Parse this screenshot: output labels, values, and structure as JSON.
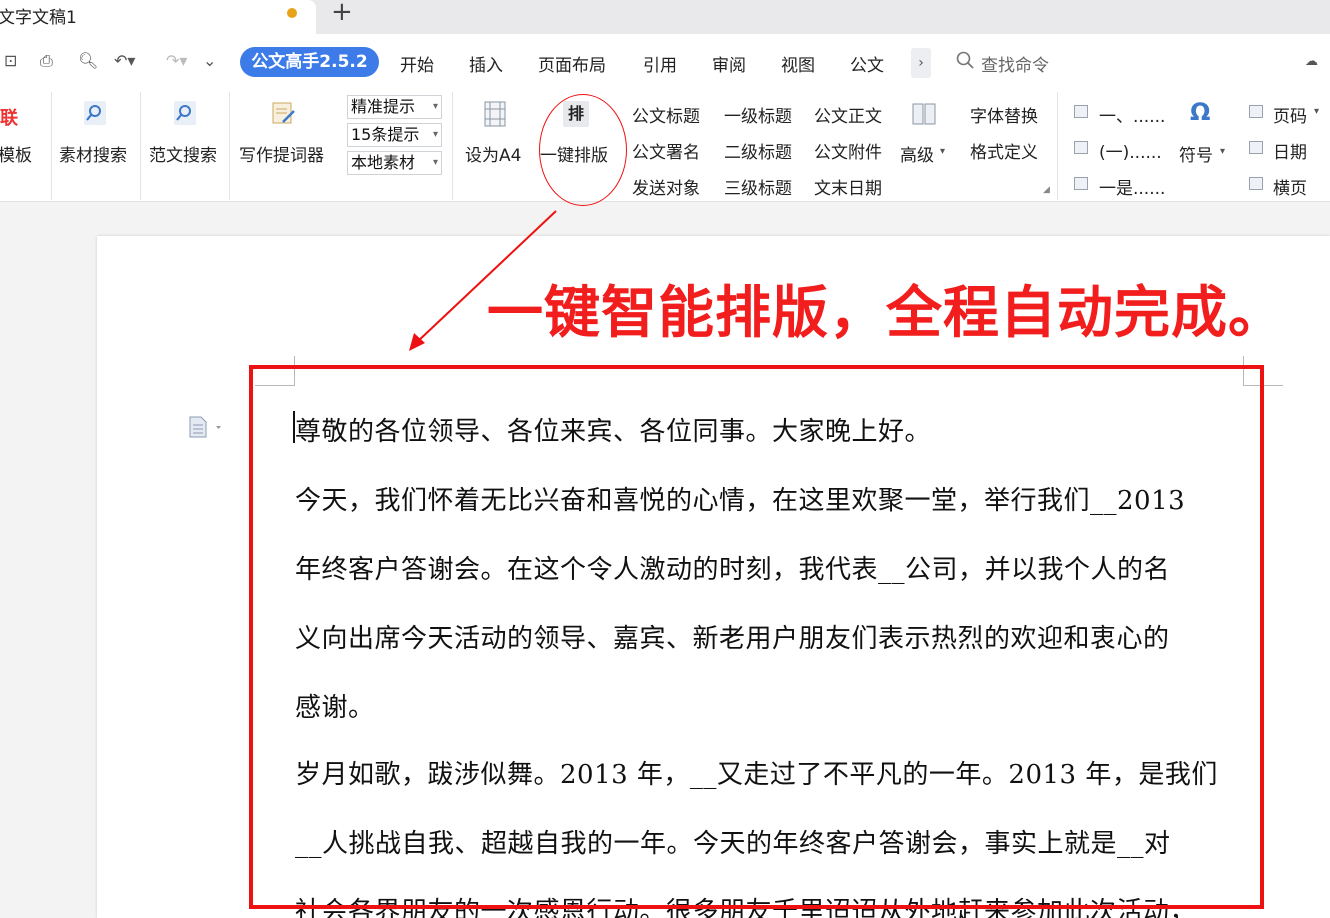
{
  "tab": {
    "title": "文字文稿1"
  },
  "brand_button": "公文高手2.5.2",
  "menu": [
    "开始",
    "插入",
    "页面布局",
    "引用",
    "审阅",
    "视图",
    "公文"
  ],
  "more_label": "›",
  "search": {
    "text": "查找命令"
  },
  "ribbon": {
    "templates": {
      "label": "模板",
      "icon_text": "联"
    },
    "material_search": {
      "label": "素材搜索"
    },
    "sample_search": {
      "label": "范文搜索"
    },
    "writing_prompter": {
      "label": "写作提词器"
    },
    "dropdowns": [
      "精准提示",
      "15条提示",
      "本地素材"
    ],
    "set_a4": {
      "label": "设为A4"
    },
    "one_key_layout": {
      "label": "一键排版",
      "icon_text": "排"
    },
    "doc_buttons": [
      [
        "公文标题",
        "一级标题",
        "公文正文"
      ],
      [
        "公文署名",
        "二级标题",
        "公文附件"
      ],
      [
        "发送对象",
        "三级标题",
        "文末日期"
      ]
    ],
    "advanced": {
      "label": "高级"
    },
    "font_replace": "字体替换",
    "format_define": "格式定义",
    "numbering": [
      "一、......",
      "(一)......",
      "一是......"
    ],
    "symbol": {
      "label": "符号",
      "icon_text": "Ω"
    },
    "page_items": [
      "页码",
      "日期",
      "横页"
    ]
  },
  "headline": "一键智能排版，全程自动完成。",
  "document": {
    "lines": [
      "尊敬的各位领导、各位来宾、各位同事。大家晚上好。",
      "今天，我们怀着无比兴奋和喜悦的心情，在这里欢聚一堂，举行我们__2013",
      "年终客户答谢会。在这个令人激动的时刻，我代表__公司，并以我个人的名",
      "义向出席今天活动的领导、嘉宾、新老用户朋友们表示热烈的欢迎和衷心的",
      "感谢。",
      "岁月如歌，跋涉似舞。2013 年，__又走过了不平凡的一年。2013 年，是我们",
      "__人挑战自我、超越自我的一年。今天的年终客户答谢会，事实上就是__对",
      "社会各界朋友的一次感恩行动。很多朋友千里迢迢从外地赶来参加此次活动，"
    ]
  },
  "colors": {
    "accent": "#3c7be8",
    "annotation": "#e11111",
    "tab_dot": "#e8a317"
  }
}
